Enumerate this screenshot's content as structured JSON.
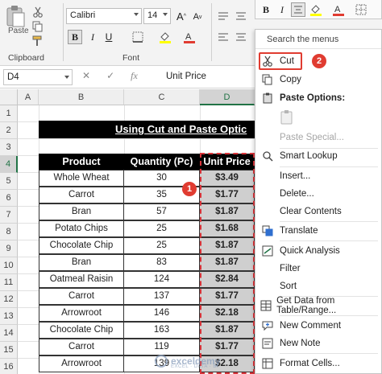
{
  "ribbon": {
    "paste_label": "Paste",
    "clipboard_label": "Clipboard",
    "font_group_label": "Font",
    "font_name": "Calibri",
    "font_size": "14",
    "bold_glyph": "B",
    "italic_glyph": "I",
    "underline_glyph": "U"
  },
  "mini_toolbar": {
    "bold_glyph": "B",
    "italic_glyph": "I"
  },
  "formula_bar": {
    "name_box": "D4",
    "cancel_glyph": "✕",
    "enter_glyph": "✓",
    "fx_glyph": "fx",
    "value": "Unit Price"
  },
  "sheet": {
    "columns": [
      "A",
      "B",
      "C",
      "D"
    ],
    "rows": [
      "1",
      "2",
      "3",
      "4",
      "5",
      "6",
      "7",
      "8",
      "9",
      "10",
      "11",
      "12",
      "13",
      "14",
      "15",
      "16"
    ],
    "selected_column": "D",
    "selected_row": "4",
    "title": "Using Cut and Paste Optic",
    "table": {
      "headers": [
        "Product",
        "Quantity (Pc)",
        "Unit Price"
      ],
      "rows": [
        [
          "Whole Wheat",
          "30",
          "$3.49"
        ],
        [
          "Carrot",
          "35",
          "$1.77"
        ],
        [
          "Bran",
          "57",
          "$1.87"
        ],
        [
          "Potato Chips",
          "25",
          "$1.68"
        ],
        [
          "Chocolate Chip",
          "25",
          "$1.87"
        ],
        [
          "Bran",
          "83",
          "$1.87"
        ],
        [
          "Oatmeal Raisin",
          "124",
          "$2.84"
        ],
        [
          "Carrot",
          "137",
          "$1.77"
        ],
        [
          "Arrowroot",
          "146",
          "$2.18"
        ],
        [
          "Chocolate Chip",
          "163",
          "$1.87"
        ],
        [
          "Carrot",
          "119",
          "$1.77"
        ],
        [
          "Arrowroot",
          "139",
          "$2.18"
        ]
      ]
    },
    "badge_1": "1",
    "watermark": {
      "name": "exceldemy",
      "tagline": "EXCEL · DATA · BI"
    }
  },
  "context_menu": {
    "search_label": "Search the menus",
    "badge_2": "2",
    "items": [
      {
        "label": "Cut",
        "icon": "scissors-icon"
      },
      {
        "label": "Copy",
        "icon": "copy-icon"
      },
      {
        "label": "Paste Options:",
        "icon": "paste-icon"
      },
      {
        "label": "Paste Special...",
        "icon": ""
      },
      {
        "label": "Smart Lookup",
        "icon": "search-icon"
      },
      {
        "label": "Insert...",
        "icon": ""
      },
      {
        "label": "Delete...",
        "icon": ""
      },
      {
        "label": "Clear Contents",
        "icon": ""
      },
      {
        "label": "Translate",
        "icon": "translate-icon"
      },
      {
        "label": "Quick Analysis",
        "icon": "quick-analysis-icon"
      },
      {
        "label": "Filter",
        "icon": ""
      },
      {
        "label": "Sort",
        "icon": ""
      },
      {
        "label": "Get Data from Table/Range...",
        "icon": "table-icon"
      },
      {
        "label": "New Comment",
        "icon": "comment-icon"
      },
      {
        "label": "New Note",
        "icon": "note-icon"
      },
      {
        "label": "Format Cells...",
        "icon": "format-cells-icon"
      }
    ]
  },
  "colors": {
    "excel_green": "#217346",
    "highlight_red": "#e03c31",
    "price_fill": "#cfcfcf"
  }
}
